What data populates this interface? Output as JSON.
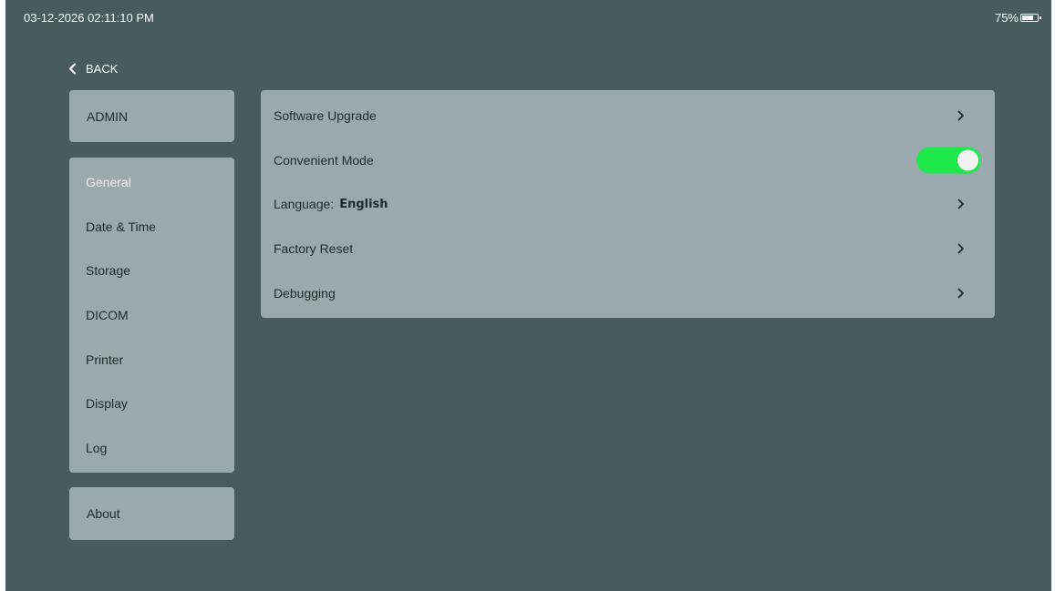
{
  "status_bar": {
    "datetime": "03-12-2026 02:11:10 PM",
    "battery": "75%",
    "battery_level_percent": 75
  },
  "back_label": "BACK",
  "sidebar": {
    "admin_label": "ADMIN",
    "items": [
      {
        "label": "General",
        "active": true
      },
      {
        "label": "Date & Time"
      },
      {
        "label": "Storage"
      },
      {
        "label": "DICOM"
      },
      {
        "label": "Printer"
      },
      {
        "label": "Display"
      },
      {
        "label": "Log"
      }
    ],
    "about_label": "About"
  },
  "settings": {
    "software_upgrade": "Software Upgrade",
    "convenient_mode": "Convenient Mode",
    "convenient_mode_on": true,
    "language_label": "Language:",
    "language_value": "English",
    "factory_reset": "Factory Reset",
    "debugging": "Debugging"
  },
  "colors": {
    "background": "#465c5f",
    "card": "#9aa9ad",
    "toggle_on": "#1ee84a"
  }
}
